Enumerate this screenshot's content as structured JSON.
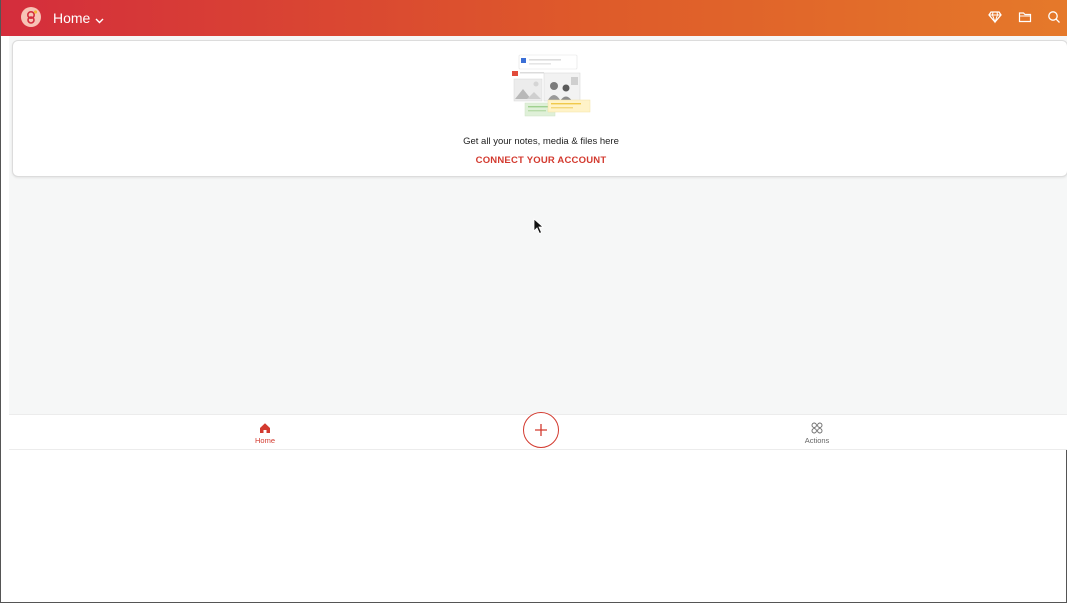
{
  "header": {
    "title": "Home",
    "icons": [
      "app-logo-icon",
      "chevron-down-icon",
      "diamond-icon",
      "folder-icon",
      "search-icon"
    ],
    "gradient_start": "#d42d3c",
    "gradient_end": "#e5792a"
  },
  "card": {
    "message": "Get all your notes, media & files here",
    "cta": "CONNECT YOUR ACCOUNT",
    "accent_color": "#d33a2f"
  },
  "bottom_nav": {
    "home_label": "Home",
    "actions_label": "Actions",
    "add_icon": "plus-icon"
  }
}
